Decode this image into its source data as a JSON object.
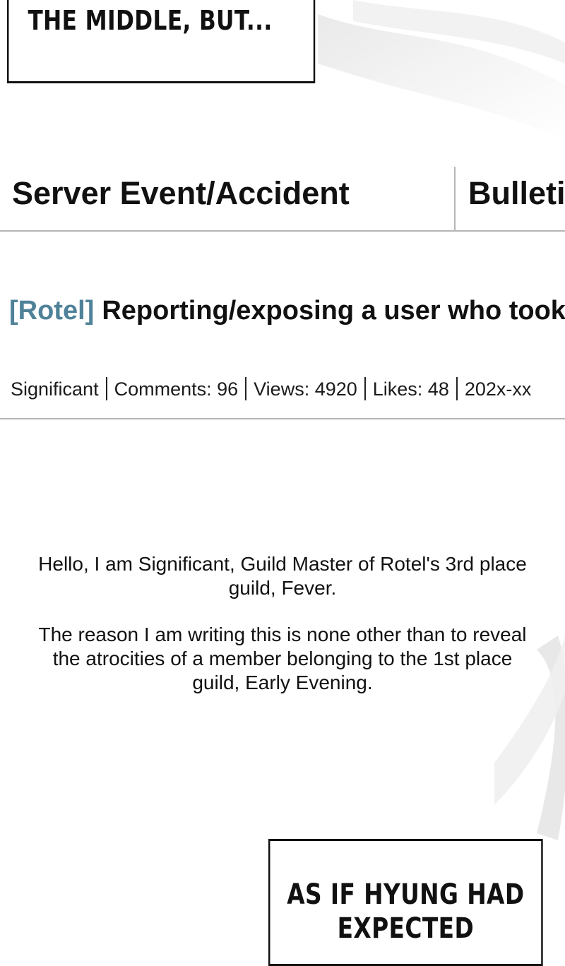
{
  "captions": {
    "top": "THE MIDDLE, BUT...",
    "bottom": "AS IF HYUNG HAD EXPECTED"
  },
  "board": {
    "tabs": [
      {
        "label": "Server Event/Accident"
      },
      {
        "label": "Bulletin"
      }
    ]
  },
  "post": {
    "tag": "[Rotel]",
    "title": "Reporting/exposing a user who took",
    "meta": {
      "author": "Significant",
      "comments": "Comments: 96",
      "views": "Views: 4920",
      "likes": "Likes: 48",
      "date": "202x-xx"
    },
    "body": [
      "Hello, I am Significant, Guild Master of Rotel's 3rd place guild, Fever.",
      "The reason I am writing this is none other than to reveal the atrocities of a member belonging to the 1st place guild, Early Evening."
    ]
  }
}
